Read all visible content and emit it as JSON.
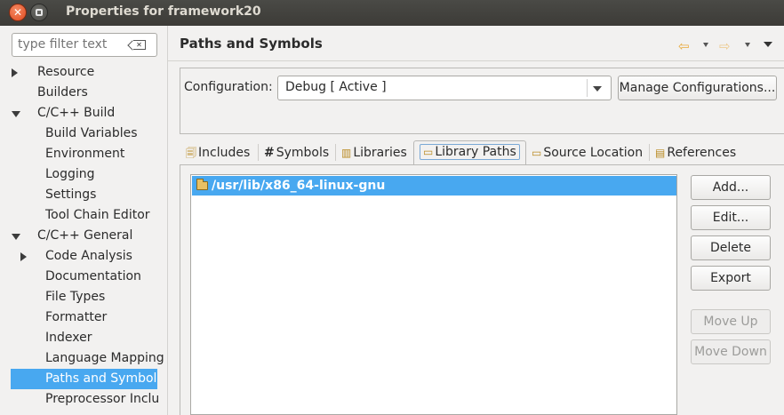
{
  "window": {
    "title": "Properties for framework20"
  },
  "filter": {
    "placeholder": "type filter text"
  },
  "tree": [
    {
      "label": "Resource",
      "level": 0,
      "expander": "right"
    },
    {
      "label": "Builders",
      "level": 0,
      "expander": "none"
    },
    {
      "label": "C/C++ Build",
      "level": 0,
      "expander": "down"
    },
    {
      "label": "Build Variables",
      "level": 1,
      "expander": "none"
    },
    {
      "label": "Environment",
      "level": 1,
      "expander": "none"
    },
    {
      "label": "Logging",
      "level": 1,
      "expander": "none"
    },
    {
      "label": "Settings",
      "level": 1,
      "expander": "none"
    },
    {
      "label": "Tool Chain Editor",
      "level": 1,
      "expander": "none"
    },
    {
      "label": "C/C++ General",
      "level": 0,
      "expander": "down"
    },
    {
      "label": "Code Analysis",
      "level": 1,
      "expander": "right"
    },
    {
      "label": "Documentation",
      "level": 1,
      "expander": "none"
    },
    {
      "label": "File Types",
      "level": 1,
      "expander": "none"
    },
    {
      "label": "Formatter",
      "level": 1,
      "expander": "none"
    },
    {
      "label": "Indexer",
      "level": 1,
      "expander": "none"
    },
    {
      "label": "Language Mapping",
      "level": 1,
      "expander": "none"
    },
    {
      "label": "Paths and Symbols",
      "level": 1,
      "expander": "none",
      "selected": true
    },
    {
      "label": "Preprocessor Inclu",
      "level": 1,
      "expander": "none"
    }
  ],
  "page": {
    "title": "Paths and Symbols"
  },
  "config": {
    "label": "Configuration:",
    "value": "Debug  [ Active ]",
    "manage_label": "Manage Configurations..."
  },
  "tabs": [
    {
      "label": "Includes",
      "icon": "includes-icon"
    },
    {
      "label": "Symbols",
      "icon": "hash-icon"
    },
    {
      "label": "Libraries",
      "icon": "libraries-icon"
    },
    {
      "label": "Library Paths",
      "icon": "folder-open-icon",
      "active": true
    },
    {
      "label": "Source Location",
      "icon": "source-folder-icon"
    },
    {
      "label": "References",
      "icon": "references-icon"
    }
  ],
  "paths": [
    "/usr/lib/x86_64-linux-gnu"
  ],
  "buttons": {
    "add": "Add...",
    "edit": "Edit...",
    "delete": "Delete",
    "export": "Export",
    "move_up": "Move Up",
    "move_down": "Move Down"
  },
  "colors": {
    "selection": "#48a8f0",
    "accent": "#e8a93b"
  }
}
